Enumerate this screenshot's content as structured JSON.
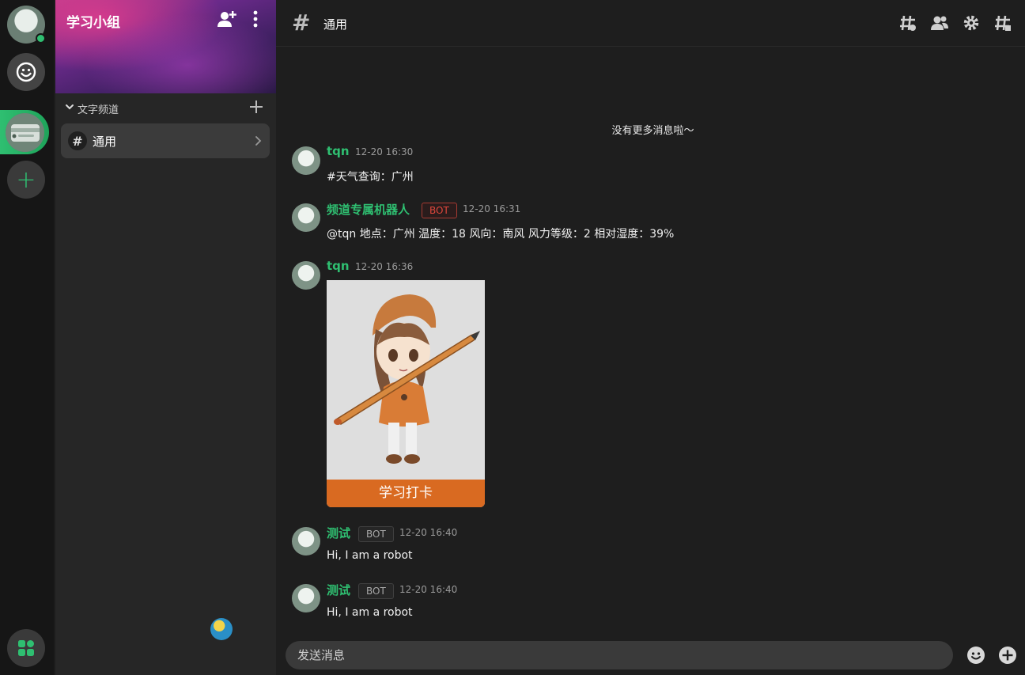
{
  "server": {
    "name": "学习小组",
    "category_label": "文字频道",
    "channels": [
      {
        "label": "通用"
      }
    ]
  },
  "header": {
    "hash_symbol": "#",
    "channel_title": "通用",
    "icons": [
      "channel-hash-icon",
      "members-icon",
      "settings-icon",
      "pinned-hash-icon"
    ]
  },
  "timeline": {
    "no_more_text": "没有更多消息啦～",
    "messages": [
      {
        "name": "tqn",
        "time": "12-20 16:30",
        "text": "#天气查询：广州",
        "bot": false
      },
      {
        "name": "频道专属机器人",
        "bot_label": "BOT",
        "time": "12-20 16:31",
        "text": "@tqn 地点：广州 温度：18 风向：南风 风力等级：2 相对湿度：39%",
        "bot": true
      },
      {
        "name": "tqn",
        "time": "12-20 16:36",
        "card_button": "学习打卡",
        "bot": false
      },
      {
        "name": "测试",
        "bot_label": "BOT",
        "time": "12-20 16:40",
        "text": "Hi, I am a robot",
        "bot": true
      },
      {
        "name": "测试",
        "bot_label": "BOT",
        "time": "12-20 16:40",
        "text": "Hi, I am a robot",
        "bot": true
      }
    ]
  },
  "composer": {
    "placeholder": "发送消息"
  },
  "colors": {
    "accent": "#2fbf71",
    "bot_red": "#e0473c",
    "card_button": "#d96a21"
  }
}
